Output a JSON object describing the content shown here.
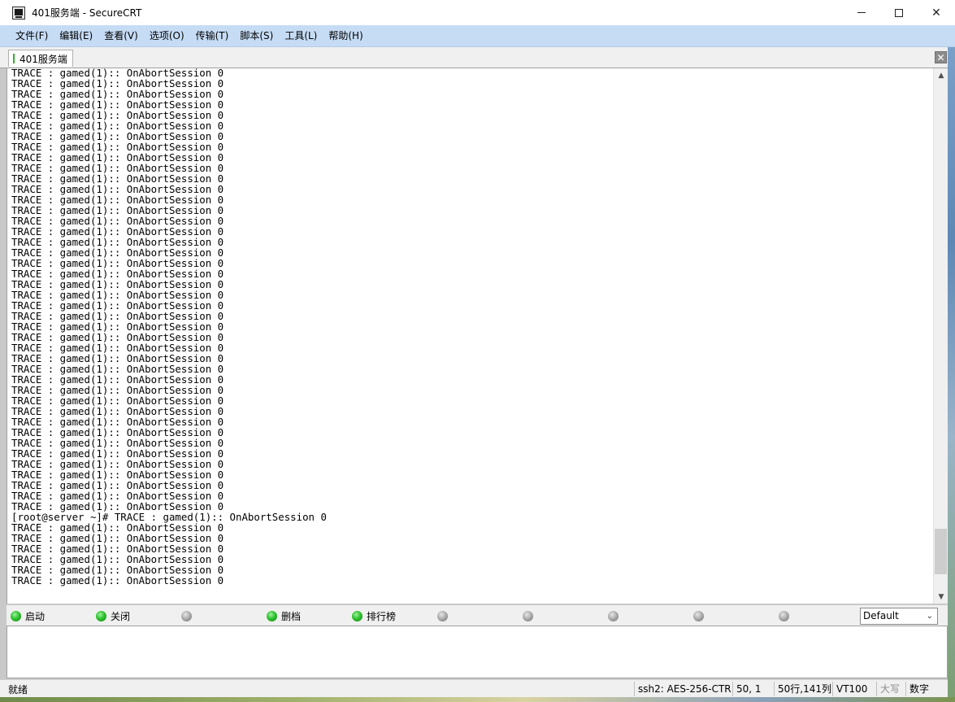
{
  "window": {
    "title": "401服务端 - SecureCRT",
    "controls": {
      "minimize": "minimize",
      "maximize": "maximize",
      "close": "✕"
    }
  },
  "menu": [
    {
      "label": "文件(F)"
    },
    {
      "label": "编辑(E)"
    },
    {
      "label": "查看(V)"
    },
    {
      "label": "选项(O)"
    },
    {
      "label": "传输(T)"
    },
    {
      "label": "脚本(S)"
    },
    {
      "label": "工具(L)"
    },
    {
      "label": "帮助(H)"
    }
  ],
  "tab": {
    "label": "401服务端",
    "close": "✕"
  },
  "terminal": {
    "repeated_line": "TRACE : gamed(1):: OnAbortSession 0",
    "lines_before_prompt": 42,
    "prompt_line": "[root@server ~]# TRACE : gamed(1):: OnAbortSession 0",
    "lines_after_prompt": 6
  },
  "scrollbar": {
    "up": "▲",
    "down": "▼",
    "thumb_start": 0.88,
    "thumb_size": 0.09
  },
  "button_bar": {
    "buttons": [
      {
        "label": "启动",
        "status": "green"
      },
      {
        "label": "关闭",
        "status": "green"
      },
      {
        "label": "",
        "status": "gray"
      },
      {
        "label": "删档",
        "status": "green"
      },
      {
        "label": "排行榜",
        "status": "green"
      },
      {
        "label": "",
        "status": "gray"
      },
      {
        "label": "",
        "status": "gray"
      },
      {
        "label": "",
        "status": "gray"
      },
      {
        "label": "",
        "status": "gray"
      },
      {
        "label": "",
        "status": "gray"
      }
    ],
    "session_select": "Default"
  },
  "status_bar": {
    "ready": "就绪",
    "cipher": "ssh2: AES-256-CTR",
    "cursor": "50,   1",
    "size": "50行,141列",
    "terminal_type": "VT100",
    "caps": "大写",
    "num": "数字"
  }
}
